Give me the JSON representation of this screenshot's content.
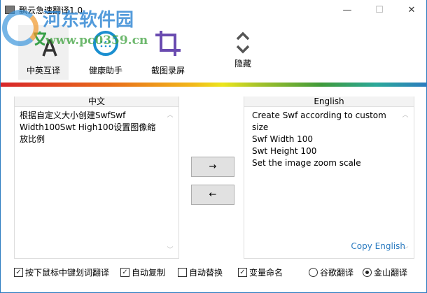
{
  "window": {
    "title": "飘云急速翻译1.0",
    "minimize": "—",
    "maximize": "☐",
    "close": "✕"
  },
  "watermark": {
    "name": "河东软件园",
    "url": "www.pc0359.cn"
  },
  "toolbar": [
    {
      "label": "中英互译",
      "active": true
    },
    {
      "label": "健康助手"
    },
    {
      "label": "截图录屏"
    },
    {
      "label": "隐藏"
    }
  ],
  "source": {
    "title": "中文",
    "text": "根据自定义大小创建SwfSwf Width100Swt High100设置图像缩放比例"
  },
  "target": {
    "title": "English",
    "text": "Create Swf according to custom size\nSwf Width 100\nSwt Height 100\nSet the image zoom scale",
    "copy_label": "Copy English"
  },
  "buttons": {
    "to_english": "→",
    "to_chinese": "←"
  },
  "options": [
    {
      "label": "按下鼠标中键划词翻译",
      "checked": true
    },
    {
      "label": "自动复制",
      "checked": true
    },
    {
      "label": "自动替换",
      "checked": false
    },
    {
      "label": "变量命名",
      "checked": true
    }
  ],
  "engines": [
    {
      "label": "谷歌翻译",
      "selected": false
    },
    {
      "label": "金山翻译",
      "selected": true
    }
  ],
  "check_mark": "✓"
}
